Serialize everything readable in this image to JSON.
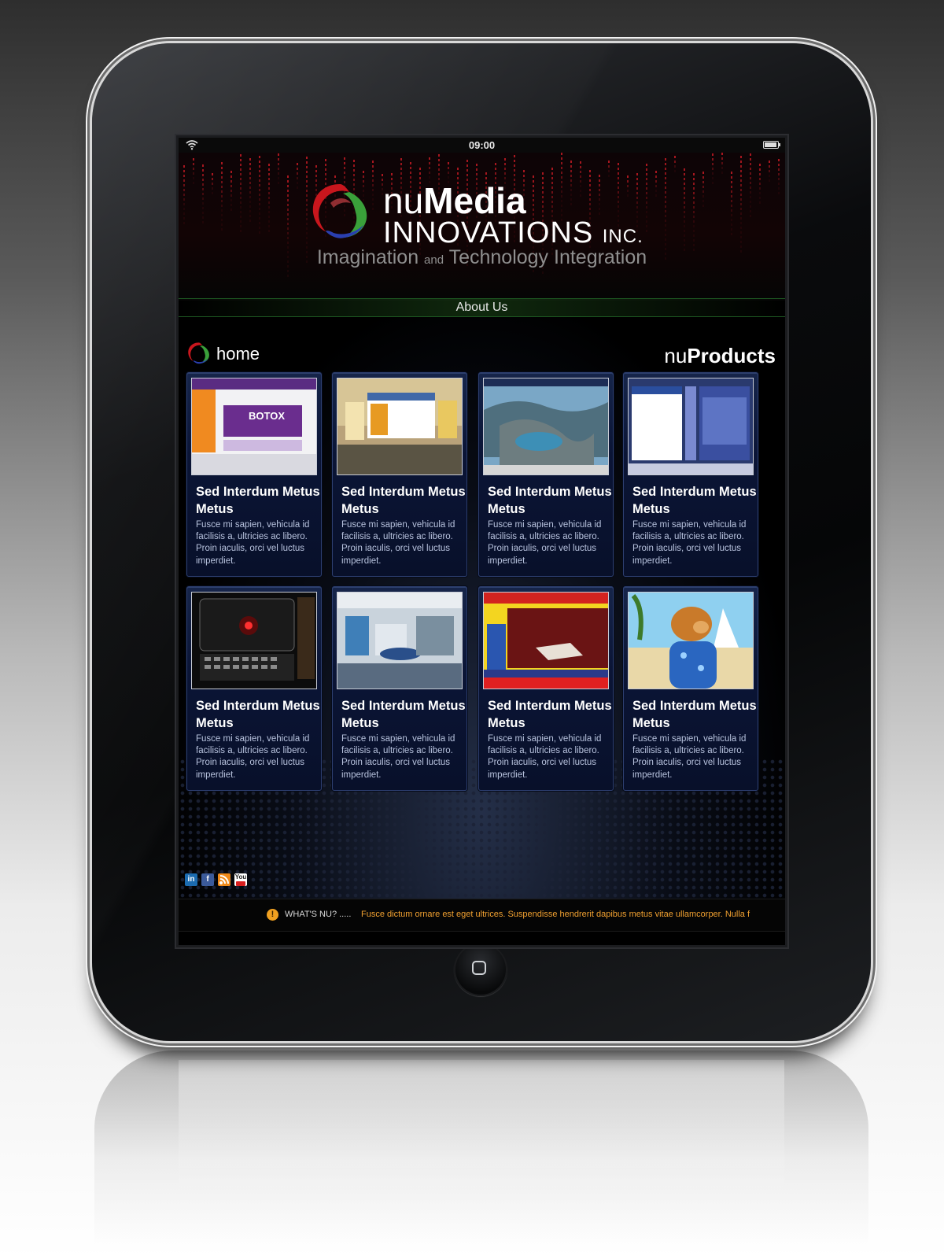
{
  "status_bar": {
    "time": "09:00",
    "icons": [
      "wifi-icon",
      "battery-icon"
    ]
  },
  "header": {
    "brand_nu": "nu",
    "brand_media": "Media",
    "brand_innovations": "INNOVATIONS",
    "brand_inc": "INC.",
    "tagline_part1": "Imagination",
    "tagline_and": "and",
    "tagline_part2": "Technology Integration"
  },
  "nav": {
    "about_label": "About Us"
  },
  "section": {
    "home_label": "home",
    "products_nu": "nu",
    "products_word": "Products"
  },
  "products": [
    {
      "title": "Sed Interdum Metus Metus",
      "description": "Fusce mi sapien, vehicula id facilisis a, ultricies ac libero. Proin iaculis, orci vel luctus imperdiet."
    },
    {
      "title": "Sed Interdum Metus Metus",
      "description": "Fusce mi sapien, vehicula id facilisis a, ultricies ac libero. Proin iaculis, orci vel luctus imperdiet."
    },
    {
      "title": "Sed Interdum Metus Metus",
      "description": "Fusce mi sapien, vehicula id facilisis a, ultricies ac libero. Proin iaculis, orci vel luctus imperdiet."
    },
    {
      "title": "Sed Interdum Metus Metus",
      "description": "Fusce mi sapien, vehicula id facilisis a, ultricies ac libero. Proin iaculis, orci vel luctus imperdiet."
    },
    {
      "title": "Sed Interdum Metus Metus",
      "description": "Fusce mi sapien, vehicula id facilisis a, ultricies ac libero. Proin iaculis, orci vel luctus imperdiet."
    },
    {
      "title": "Sed Interdum Metus Metus",
      "description": "Fusce mi sapien, vehicula id facilisis a, ultricies ac libero. Proin iaculis, orci vel luctus imperdiet."
    },
    {
      "title": "Sed Interdum Metus Metus",
      "description": "Fusce mi sapien, vehicula id facilisis a, ultricies ac libero. Proin iaculis, orci vel luctus imperdiet."
    },
    {
      "title": "Sed Interdum Metus Metus",
      "description": "Fusce mi sapien, vehicula id facilisis a, ultricies ac libero. Proin iaculis, orci vel luctus imperdiet."
    }
  ],
  "thumbnail_labels": {
    "botox": "BOTOX"
  },
  "social": {
    "linkedin": "in",
    "facebook": "f",
    "youtube": "You",
    "icons": [
      "linkedin-icon",
      "facebook-icon",
      "rss-icon",
      "youtube-icon"
    ]
  },
  "ticker": {
    "label": "WHAT'S NU? .....",
    "text": "Fusce dictum ornare est eget ultrices. Suspendisse hendrerit dapibus metus vitae ullamcorper. Nulla f"
  },
  "colors": {
    "card_bg": "#0b1536",
    "card_border": "#2d3f70",
    "ticker_text": "#f0a030",
    "accent_green": "#1e5a22",
    "logo_red": "#c8161d",
    "logo_green": "#3aa03a",
    "logo_blue": "#2a3fb0"
  }
}
